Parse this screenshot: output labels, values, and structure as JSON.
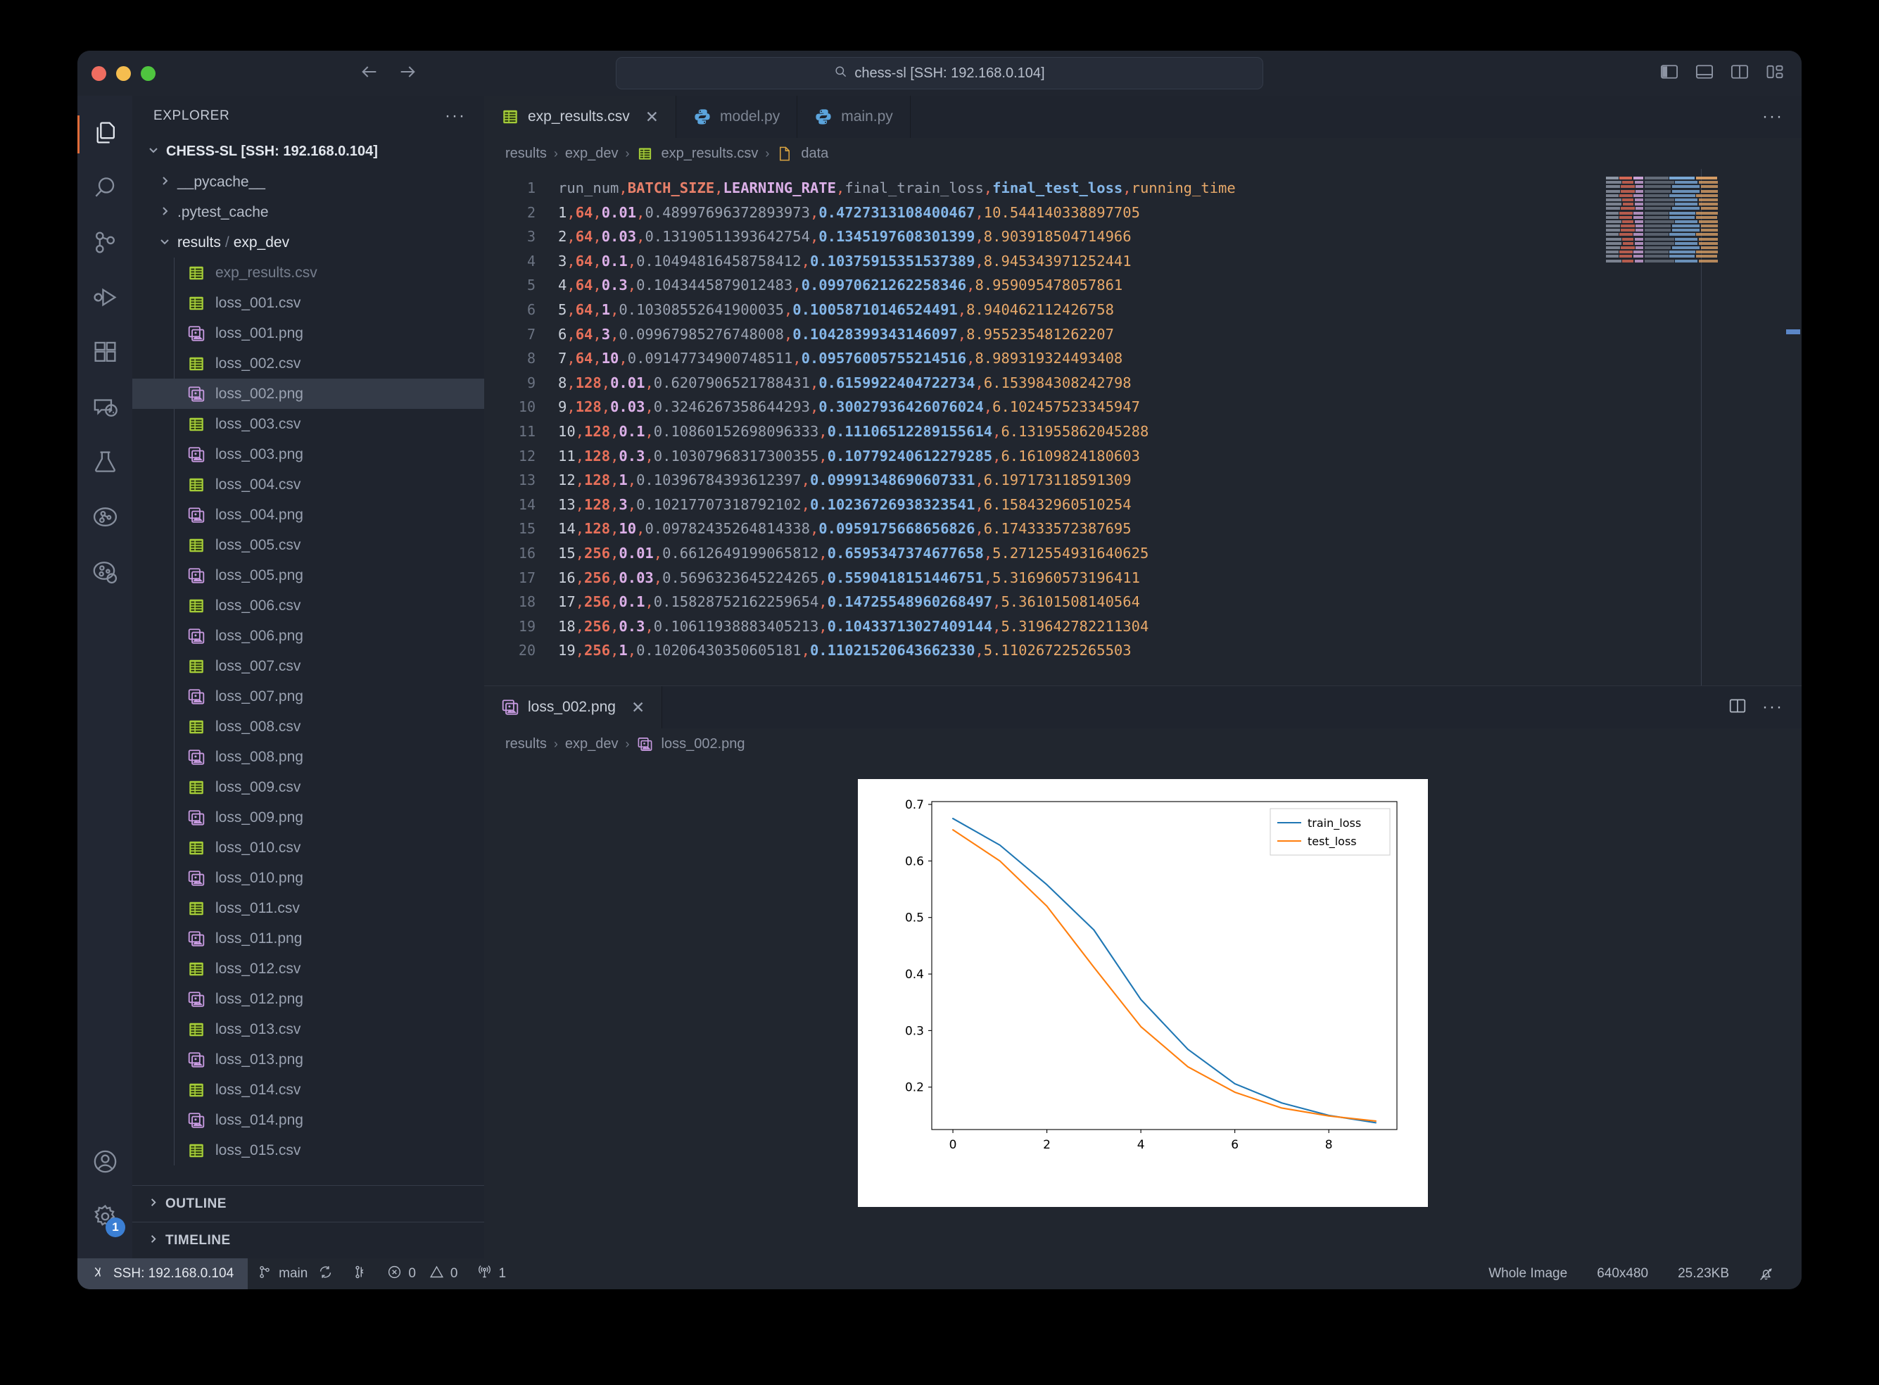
{
  "window": {
    "traffic_lights": [
      "close",
      "minimize",
      "maximize"
    ],
    "search_placeholder": "chess-sl [SSH: 192.168.0.104]",
    "nav_back": "back-arrow",
    "nav_forward": "forward-arrow"
  },
  "activitybar": {
    "items": [
      {
        "name": "explorer",
        "icon": "files-icon",
        "active": true
      },
      {
        "name": "search",
        "icon": "search-icon",
        "active": false
      },
      {
        "name": "source-control",
        "icon": "source-control-icon",
        "active": false
      },
      {
        "name": "run-and-debug",
        "icon": "run-debug-icon",
        "active": false
      },
      {
        "name": "extensions",
        "icon": "extensions-icon",
        "active": false
      },
      {
        "name": "remote-explorer",
        "icon": "remote-explorer-icon",
        "active": false
      },
      {
        "name": "testing",
        "icon": "beaker-icon",
        "active": false
      },
      {
        "name": "graph-one",
        "icon": "graph-circle-icon",
        "active": false
      },
      {
        "name": "graph-two",
        "icon": "graph-search-icon",
        "active": false
      }
    ],
    "account_icon": "account-icon",
    "settings_icon": "gear-icon",
    "settings_badge": "1"
  },
  "sidebar": {
    "title": "EXPLORER",
    "more_actions": "···",
    "root": "CHESS-SL [SSH: 192.168.0.104]",
    "folders": [
      {
        "label": "__pycache__",
        "expanded": false
      },
      {
        "label": ".pytest_cache",
        "expanded": false
      }
    ],
    "results_folder": {
      "label_a": "results",
      "sep": "/",
      "label_b": "exp_dev",
      "expanded": true
    },
    "files": [
      {
        "name": "exp_results.csv",
        "type": "csv",
        "selected": false,
        "muted": true
      },
      {
        "name": "loss_001.csv",
        "type": "csv",
        "selected": false,
        "muted": false
      },
      {
        "name": "loss_001.png",
        "type": "png",
        "selected": false,
        "muted": false
      },
      {
        "name": "loss_002.csv",
        "type": "csv",
        "selected": false,
        "muted": false
      },
      {
        "name": "loss_002.png",
        "type": "png",
        "selected": true,
        "muted": false
      },
      {
        "name": "loss_003.csv",
        "type": "csv",
        "selected": false,
        "muted": false
      },
      {
        "name": "loss_003.png",
        "type": "png",
        "selected": false,
        "muted": false
      },
      {
        "name": "loss_004.csv",
        "type": "csv",
        "selected": false,
        "muted": false
      },
      {
        "name": "loss_004.png",
        "type": "png",
        "selected": false,
        "muted": false
      },
      {
        "name": "loss_005.csv",
        "type": "csv",
        "selected": false,
        "muted": false
      },
      {
        "name": "loss_005.png",
        "type": "png",
        "selected": false,
        "muted": false
      },
      {
        "name": "loss_006.csv",
        "type": "csv",
        "selected": false,
        "muted": false
      },
      {
        "name": "loss_006.png",
        "type": "png",
        "selected": false,
        "muted": false
      },
      {
        "name": "loss_007.csv",
        "type": "csv",
        "selected": false,
        "muted": false
      },
      {
        "name": "loss_007.png",
        "type": "png",
        "selected": false,
        "muted": false
      },
      {
        "name": "loss_008.csv",
        "type": "csv",
        "selected": false,
        "muted": false
      },
      {
        "name": "loss_008.png",
        "type": "png",
        "selected": false,
        "muted": false
      },
      {
        "name": "loss_009.csv",
        "type": "csv",
        "selected": false,
        "muted": false
      },
      {
        "name": "loss_009.png",
        "type": "png",
        "selected": false,
        "muted": false
      },
      {
        "name": "loss_010.csv",
        "type": "csv",
        "selected": false,
        "muted": false
      },
      {
        "name": "loss_010.png",
        "type": "png",
        "selected": false,
        "muted": false
      },
      {
        "name": "loss_011.csv",
        "type": "csv",
        "selected": false,
        "muted": false
      },
      {
        "name": "loss_011.png",
        "type": "png",
        "selected": false,
        "muted": false
      },
      {
        "name": "loss_012.csv",
        "type": "csv",
        "selected": false,
        "muted": false
      },
      {
        "name": "loss_012.png",
        "type": "png",
        "selected": false,
        "muted": false
      },
      {
        "name": "loss_013.csv",
        "type": "csv",
        "selected": false,
        "muted": false
      },
      {
        "name": "loss_013.png",
        "type": "png",
        "selected": false,
        "muted": false
      },
      {
        "name": "loss_014.csv",
        "type": "csv",
        "selected": false,
        "muted": false
      },
      {
        "name": "loss_014.png",
        "type": "png",
        "selected": false,
        "muted": false
      },
      {
        "name": "loss_015.csv",
        "type": "csv",
        "selected": false,
        "muted": false
      }
    ],
    "sections": [
      {
        "label": "OUTLINE",
        "expanded": false
      },
      {
        "label": "TIMELINE",
        "expanded": false
      }
    ]
  },
  "editor_top": {
    "tabs": [
      {
        "label": "exp_results.csv",
        "icon": "csv-file-icon",
        "active": true,
        "closable": true
      },
      {
        "label": "model.py",
        "icon": "python-file-icon",
        "active": false,
        "closable": false
      },
      {
        "label": "main.py",
        "icon": "python-file-icon",
        "active": false,
        "closable": false
      }
    ],
    "tab_close_glyph": "✕",
    "more_actions": "···",
    "breadcrumb": [
      {
        "label": "results",
        "icon": null
      },
      {
        "label": "exp_dev",
        "icon": null
      },
      {
        "label": "exp_results.csv",
        "icon": "csv-file-icon"
      },
      {
        "label": "data",
        "icon": "data-file-icon"
      }
    ],
    "breadcrumb_sep": "›",
    "header": {
      "run_num": "run_num",
      "batch_size": "BATCH_SIZE",
      "learning_rate": "LEARNING_RATE",
      "final_train_loss": "final_train_loss",
      "final_test_loss": "final_test_loss",
      "running_time": "running_time"
    },
    "rows": [
      {
        "n": "1",
        "bs": "64",
        "lr": "0.01",
        "train": "0.48997696372893973",
        "test": "0.4727313108400467",
        "time": "10.544140338897705"
      },
      {
        "n": "2",
        "bs": "64",
        "lr": "0.03",
        "train": "0.13190511393642754",
        "test": "0.1345197608301399",
        "time": "8.903918504714966"
      },
      {
        "n": "3",
        "bs": "64",
        "lr": "0.1",
        "train": "0.10494816458758412",
        "test": "0.10375915351537389",
        "time": "8.945343971252441"
      },
      {
        "n": "4",
        "bs": "64",
        "lr": "0.3",
        "train": "0.1043445879012483",
        "test": "0.09970621262258346",
        "time": "8.959095478057861"
      },
      {
        "n": "5",
        "bs": "64",
        "lr": "1",
        "train": "0.10308552641900035",
        "test": "0.10058710146524491",
        "time": "8.940462112426758"
      },
      {
        "n": "6",
        "bs": "64",
        "lr": "3",
        "train": "0.09967985276748008",
        "test": "0.10428399343146097",
        "time": "8.955235481262207"
      },
      {
        "n": "7",
        "bs": "64",
        "lr": "10",
        "train": "0.09147734900748511",
        "test": "0.09576005755214516",
        "time": "8.989319324493408"
      },
      {
        "n": "8",
        "bs": "128",
        "lr": "0.01",
        "train": "0.6207906521788431",
        "test": "0.6159922404722734",
        "time": "6.153984308242798"
      },
      {
        "n": "9",
        "bs": "128",
        "lr": "0.03",
        "train": "0.3246267358644293",
        "test": "0.30027936426076024",
        "time": "6.102457523345947"
      },
      {
        "n": "10",
        "bs": "128",
        "lr": "0.1",
        "train": "0.10860152698096333",
        "test": "0.11106512289155614",
        "time": "6.131955862045288"
      },
      {
        "n": "11",
        "bs": "128",
        "lr": "0.3",
        "train": "0.10307968317300355",
        "test": "0.10779240612279285",
        "time": "6.16109824180603"
      },
      {
        "n": "12",
        "bs": "128",
        "lr": "1",
        "train": "0.10396784393612397",
        "test": "0.09991348690607331",
        "time": "6.197173118591309"
      },
      {
        "n": "13",
        "bs": "128",
        "lr": "3",
        "train": "0.10217707318792102",
        "test": "0.10236726938323541",
        "time": "6.158432960510254"
      },
      {
        "n": "14",
        "bs": "128",
        "lr": "10",
        "train": "0.09782435264814338",
        "test": "0.0959175668656826",
        "time": "6.174333572387695"
      },
      {
        "n": "15",
        "bs": "256",
        "lr": "0.01",
        "train": "0.6612649199065812",
        "test": "0.6595347374677658",
        "time": "5.2712554931640625"
      },
      {
        "n": "16",
        "bs": "256",
        "lr": "0.03",
        "train": "0.5696323645224265",
        "test": "0.5590418151446751",
        "time": "5.316960573196411"
      },
      {
        "n": "17",
        "bs": "256",
        "lr": "0.1",
        "train": "0.15828752162259654",
        "test": "0.14725548960268497",
        "time": "5.36101508140564"
      },
      {
        "n": "18",
        "bs": "256",
        "lr": "0.3",
        "train": "0.10611938883405213",
        "test": "0.10433713027409144",
        "time": "5.319642782211304"
      },
      {
        "n": "19",
        "bs": "256",
        "lr": "1",
        "train": "0.10206430350605181",
        "test": "0.11021520643662330",
        "time": "5.110267225265503"
      }
    ]
  },
  "editor_bottom": {
    "tabs": [
      {
        "label": "loss_002.png",
        "icon": "png-file-icon",
        "active": true,
        "closable": true
      }
    ],
    "tab_close_glyph": "✕",
    "split_icon": "split-editor-icon",
    "more_actions": "···",
    "breadcrumb": [
      {
        "label": "results",
        "icon": null
      },
      {
        "label": "exp_dev",
        "icon": null
      },
      {
        "label": "loss_002.png",
        "icon": "png-file-icon"
      }
    ],
    "breadcrumb_sep": "›"
  },
  "statusbar": {
    "remote_label": "SSH: 192.168.0.104",
    "remote_icon": "remote-indicator-icon",
    "branch_label": "main",
    "branch_icon": "source-control-icon",
    "sync_icon": "sync-icon",
    "branch_extra_icon": "source-control-graph-icon",
    "errors_icon": "error-icon",
    "errors_count": "0",
    "warnings_icon": "warning-icon",
    "warnings_count": "0",
    "ports_icon": "radio-tower-icon",
    "ports_count": "1",
    "image_mode": "Whole Image",
    "image_size": "640x480",
    "image_filesize": "25.23KB",
    "bell_icon": "notifications-bell-icon"
  },
  "chart_data": {
    "type": "line",
    "title": "",
    "xlabel": "",
    "ylabel": "",
    "xlim": [
      -0.45,
      9.45
    ],
    "ylim": [
      0.125,
      0.705
    ],
    "xticks": [
      0,
      2,
      4,
      6,
      8
    ],
    "yticks": [
      0.2,
      0.3,
      0.4,
      0.5,
      0.6,
      0.7
    ],
    "ytick_labels": [
      "0.2",
      "0.3",
      "0.4",
      "0.5",
      "0.6",
      "0.7"
    ],
    "xtick_labels": [
      "0",
      "2",
      "4",
      "6",
      "8"
    ],
    "grid": false,
    "legend_position": "upper right",
    "x": [
      0,
      1,
      2,
      3,
      4,
      5,
      6,
      7,
      8,
      9
    ],
    "series": [
      {
        "name": "train_loss",
        "color": "#1f77b4",
        "values": [
          0.675,
          0.628,
          0.558,
          0.478,
          0.355,
          0.267,
          0.206,
          0.172,
          0.15,
          0.137
        ]
      },
      {
        "name": "test_loss",
        "color": "#ff7f0e",
        "values": [
          0.655,
          0.6,
          0.52,
          0.412,
          0.307,
          0.236,
          0.191,
          0.163,
          0.149,
          0.14
        ]
      }
    ]
  },
  "colors": {
    "accent": "#3b7fd4",
    "active_indicator": "#e06c3a",
    "csv_icon": "#a6ce39",
    "png_icon": "#c79ae0",
    "python_icon": "#5ba4dc",
    "train_line": "#1f77b4",
    "test_line": "#ff7f0e"
  }
}
